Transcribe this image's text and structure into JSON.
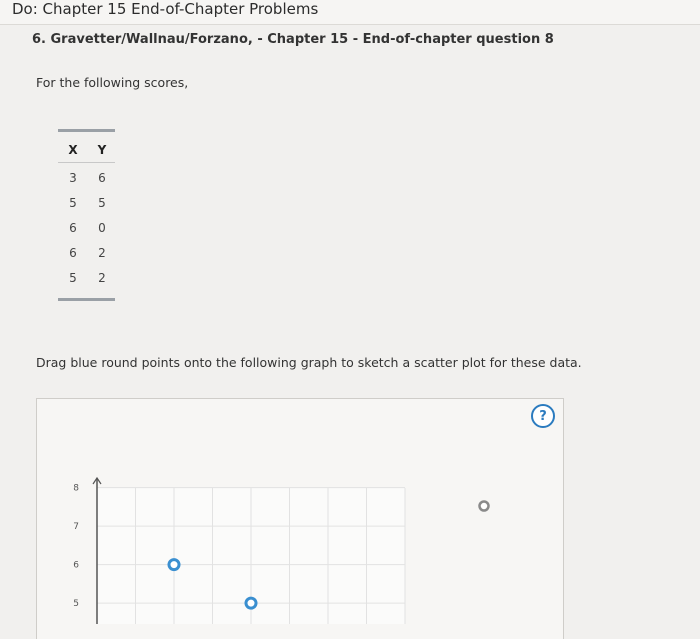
{
  "header": {
    "title": "Do: Chapter 15 End-of-Chapter Problems"
  },
  "question": {
    "title": "6. Gravetter/Wallnau/Forzano, - Chapter 15 - End-of-chapter question 8"
  },
  "prompt": "For the following scores,",
  "table": {
    "headers": [
      "X",
      "Y"
    ],
    "rows": [
      [
        "3",
        "6"
      ],
      [
        "5",
        "5"
      ],
      [
        "6",
        "0"
      ],
      [
        "6",
        "2"
      ],
      [
        "5",
        "2"
      ]
    ]
  },
  "instructions": "Drag blue round points onto the following graph to sketch a scatter plot for these data.",
  "graph": {
    "help_label": "?",
    "y_ticks": [
      "8",
      "7",
      "6",
      "5"
    ],
    "placed_points": [
      {
        "x": 3,
        "y": 6
      },
      {
        "x": 5,
        "y": 5
      }
    ],
    "unplaced_point_count": 1,
    "point_color": "#3a8fd0",
    "palette_point_color": "#8a8a8a"
  }
}
